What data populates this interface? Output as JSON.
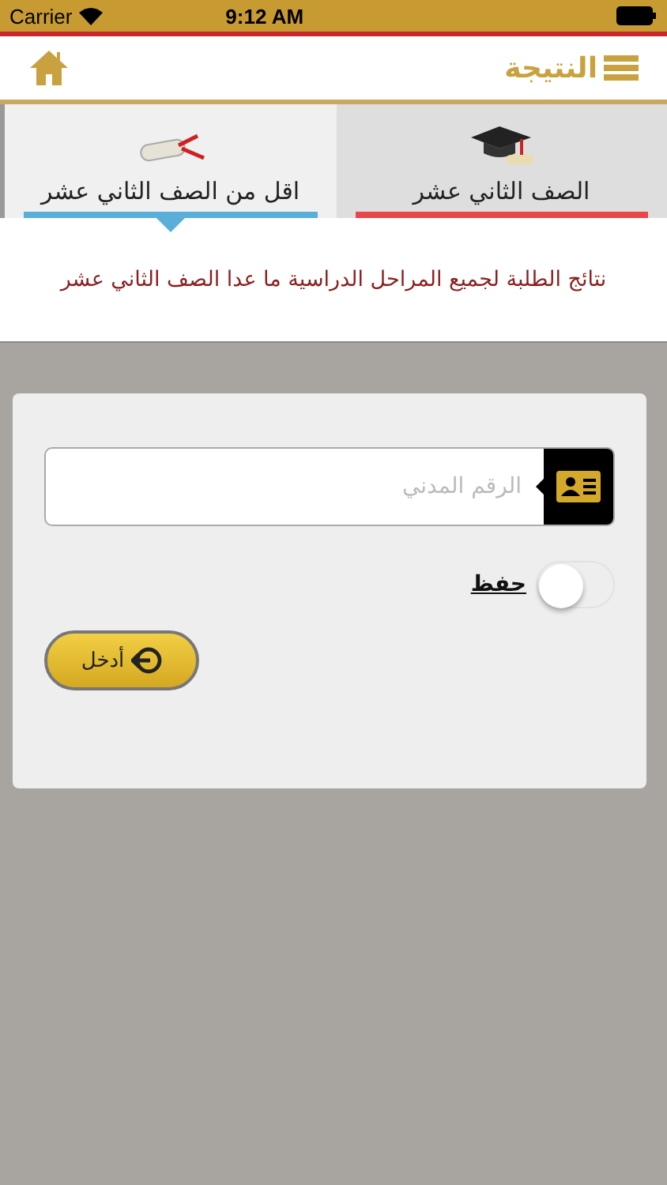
{
  "status_bar": {
    "carrier": "Carrier",
    "time": "9:12 AM"
  },
  "header": {
    "title": "النتيجة"
  },
  "tabs": [
    {
      "label": "الصف الثاني عشر",
      "selected": false,
      "kind": "cap"
    },
    {
      "label": "اقل من الصف الثاني عشر",
      "selected": true,
      "kind": "diploma"
    }
  ],
  "description": "نتائج الطلبة لجميع المراحل الدراسية ما عدا الصف الثاني عشر",
  "form": {
    "civil_id": {
      "placeholder": "الرقم المدني"
    },
    "remember": {
      "label": "حفظ",
      "on": false
    },
    "submit": "أدخل"
  }
}
